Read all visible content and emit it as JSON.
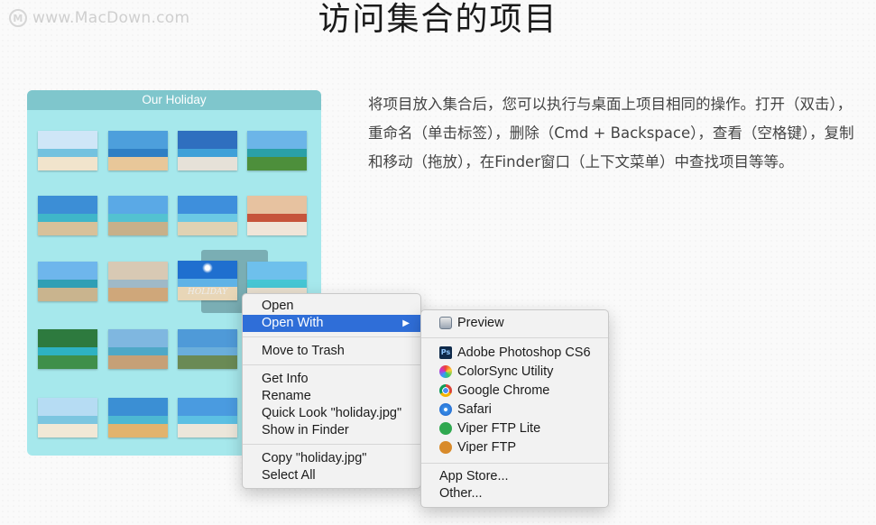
{
  "watermark": {
    "logo": "M",
    "text": "www.MacDown.com"
  },
  "heading": "访问集合的项目",
  "description": "将项目放入集合后，您可以执行与桌面上项目相同的操作。打开（双击），重命名（单击标签），删除（Cmd + Backspace），查看（空格键），复制和移动（拖放），在Finder窗口（上下文菜单）中查找项目等等。",
  "collection": {
    "title": "Our Holiday",
    "selected_label": "HOLIDAY",
    "thumbnails": [
      {
        "sky": "#cfe6f7",
        "sea": "#74c2df",
        "sand": "#f1e4cc"
      },
      {
        "sky": "#4d9fdc",
        "sea": "#2f7fc4",
        "sand": "#e8c799"
      },
      {
        "sky": "#2f6fbf",
        "sea": "#3fa0d8",
        "sand": "#e6e1d8"
      },
      {
        "sky": "#6cb5e8",
        "sea": "#2aa0a8",
        "sand": "#4d8f3b"
      },
      {
        "sky": "#3c8ed6",
        "sea": "#3fb6c9",
        "sand": "#d8c19a"
      },
      {
        "sky": "#5aa9e6",
        "sea": "#53c2d1",
        "sand": "#c7b08a"
      },
      {
        "sky": "#3e8fdc",
        "sea": "#6bc9e4",
        "sand": "#e0d2b3"
      },
      {
        "sky": "#e7c2a0",
        "sea": "#c6543b",
        "sand": "#f0e5d8"
      },
      {
        "sky": "#6eb6ec",
        "sea": "#2f9fb5",
        "sand": "#c9b48e"
      },
      {
        "sky": "#d8c9b4",
        "sea": "#9fb9c7",
        "sand": "#cfa77a"
      },
      {
        "sky": "#1f6fcf",
        "sea": "#5fb2e6",
        "sand": "#e8d6b7"
      },
      {
        "sky": "#6ec0ec",
        "sea": "#46c6d4",
        "sand": "#e9dfcf"
      },
      {
        "sky": "#2d7a3e",
        "sea": "#2eb2c2",
        "sand": "#3f8f4a"
      },
      {
        "sky": "#7fb7e0",
        "sea": "#4fa8c7",
        "sand": "#c6a077"
      },
      {
        "sky": "#4f9ad8",
        "sea": "#6aaedb",
        "sand": "#6a8a55"
      },
      {
        "sky": "#9ad3f0",
        "sea": "#7fd1e2",
        "sand": "#f2ead9"
      },
      {
        "sky": "#b6dcf3",
        "sea": "#7cc6e0",
        "sand": "#f1e8d6"
      },
      {
        "sky": "#3b8fd4",
        "sea": "#4db8d2",
        "sand": "#e2b36d"
      },
      {
        "sky": "#4a9be0",
        "sea": "#5cc0e3",
        "sand": "#ece6da"
      }
    ]
  },
  "context_menu": {
    "open": "Open",
    "open_with": "Open With",
    "move_to_trash": "Move to Trash",
    "get_info": "Get Info",
    "rename": "Rename",
    "quick_look": "Quick Look \"holiday.jpg\"",
    "show_in_finder": "Show in Finder",
    "copy": "Copy \"holiday.jpg\"",
    "select_all": "Select All"
  },
  "submenu": {
    "preview": "Preview",
    "photoshop": "Adobe Photoshop CS6",
    "photoshop_icon": "Ps",
    "colorsync": "ColorSync Utility",
    "chrome": "Google Chrome",
    "safari": "Safari",
    "viper_lite": "Viper FTP Lite",
    "viper": "Viper FTP",
    "app_store": "App Store...",
    "other": "Other..."
  },
  "colors": {
    "collection_bg": "#a6e8ec",
    "title_bar": "#7fc6cc",
    "menu_highlight": "#2f6ed8"
  }
}
